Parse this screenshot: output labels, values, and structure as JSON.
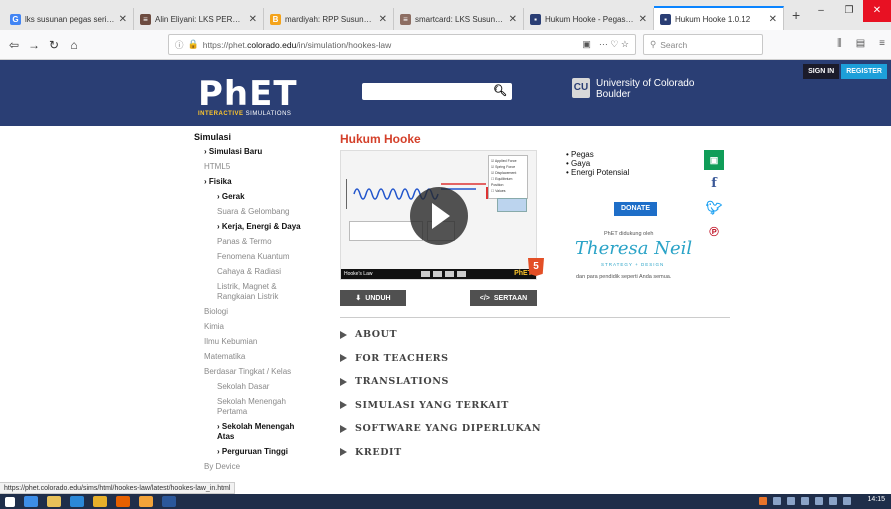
{
  "browser": {
    "tabs": [
      {
        "title": "lks susunan pegas seri dan",
        "fav_color": "#4285f4",
        "fav_char": "G",
        "active": false
      },
      {
        "title": "Alin Eliyani: LKS PERCOBAAN",
        "fav_color": "#6d4c41",
        "fav_char": "≡",
        "active": false
      },
      {
        "title": "mardiyah: RPP Susunan Pegas",
        "fav_color": "#f4a31a",
        "fav_char": "B",
        "active": false
      },
      {
        "title": "smartcard: LKS Susunan Pegas",
        "fav_color": "#8d6e63",
        "fav_char": "≡",
        "active": false
      },
      {
        "title": "Hukum Hooke - Pegas, Gaya",
        "fav_color": "#2a3e74",
        "fav_char": "▪",
        "active": false
      },
      {
        "title": "Hukum Hooke 1.0.12",
        "fav_color": "#2a3e74",
        "fav_char": "▪",
        "active": true
      }
    ],
    "new_tab": "+",
    "url_prefix": "https://phet.",
    "url_host": "colorado.edu",
    "url_path": "/in/simulation/hookes-law",
    "search_placeholder": "Search",
    "page_actions": "··· ♡ ☆"
  },
  "header": {
    "logo": "PhET",
    "logo_sub_bold": "INTERACTIVE",
    "logo_sub": " SIMULATIONS",
    "university": "University of Colorado",
    "university_city": "Boulder",
    "sign_in": "SIGN IN",
    "register": "REGISTER"
  },
  "sidebar": {
    "items": [
      {
        "label": "Simulasi",
        "cls": "bold title"
      },
      {
        "label": "› Simulasi Baru",
        "cls": "bold lvl1"
      },
      {
        "label": "HTML5",
        "cls": "lvl1"
      },
      {
        "label": "› Fisika",
        "cls": "bold lvl1"
      },
      {
        "label": "› Gerak",
        "cls": "bold lvl2"
      },
      {
        "label": "Suara & Gelombang",
        "cls": "lvl2"
      },
      {
        "label": "› Kerja, Energi & Daya",
        "cls": "bold lvl2"
      },
      {
        "label": "Panas & Termo",
        "cls": "lvl2"
      },
      {
        "label": "Fenomena Kuantum",
        "cls": "lvl2"
      },
      {
        "label": "Cahaya & Radiasi",
        "cls": "lvl2"
      },
      {
        "label": "Listrik, Magnet & Rangkaian Listrik",
        "cls": "lvl2"
      },
      {
        "label": "Biologi",
        "cls": "lvl1"
      },
      {
        "label": "Kimia",
        "cls": "lvl1"
      },
      {
        "label": "Ilmu Kebumian",
        "cls": "lvl1"
      },
      {
        "label": "Matematika",
        "cls": "lvl1"
      },
      {
        "label": "Berdasar Tingkat / Kelas",
        "cls": "lvl1"
      },
      {
        "label": "Sekolah Dasar",
        "cls": "lvl2"
      },
      {
        "label": "Sekolah Menengah Pertama",
        "cls": "lvl2"
      },
      {
        "label": "› Sekolah Menengah Atas",
        "cls": "bold lvl2"
      },
      {
        "label": "› Perguruan Tinggi",
        "cls": "bold lvl2"
      },
      {
        "label": "By Device",
        "cls": "lvl1"
      }
    ]
  },
  "main": {
    "title": "Hukum Hooke",
    "sim_caption": "Hooke's Law",
    "sim_brand": "PhET",
    "sim_panel": [
      "☑ Applied Force",
      "☑ Spring Force",
      "☑ Displacement",
      "☐ Equilibrium Position",
      "☐ Values"
    ],
    "download": "UNDUH",
    "embed": "SERTAAN",
    "topics": [
      "Pegas",
      "Gaya",
      "Energi Potensial"
    ],
    "donate": "DONATE",
    "supported_by": "PhET didukung oleh",
    "sponsor": "Theresa Neil",
    "sponsor_sub": "STRATEGY + DESIGN",
    "partners": "dan para pendidik seperti Anda semua.",
    "accordion": [
      "ABOUT",
      "FOR TEACHERS",
      "TRANSLATIONS",
      "SIMULASI YANG TERKAIT",
      "SOFTWARE YANG DIPERLUKAN",
      "KREDIT"
    ]
  },
  "status": {
    "url": "https://phet.colorado.edu/sims/html/hookes-law/latest/hookes-law_in.html"
  },
  "taskbar": {
    "clock": "14:15"
  }
}
